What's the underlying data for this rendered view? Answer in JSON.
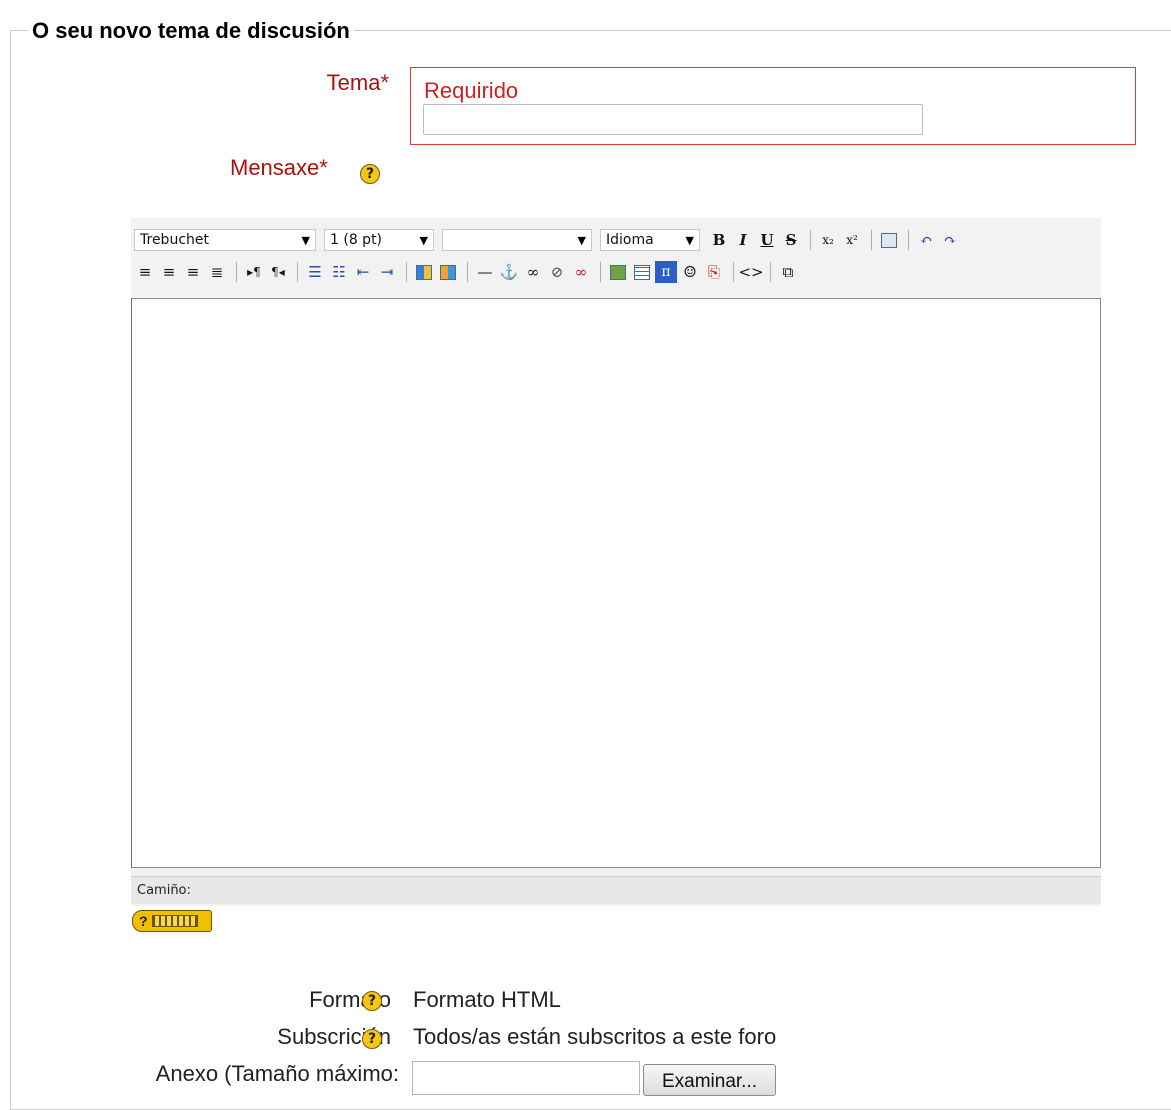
{
  "form": {
    "legend": "O seu novo tema de discusión",
    "tema_label": "Tema*",
    "tema_error": "Requirido",
    "tema_value": "",
    "mensaxe_label": "Mensaxe*",
    "help_glyph": "?"
  },
  "editor": {
    "font_family": "Trebuchet",
    "font_size": "1 (8 pt)",
    "heading": "",
    "language": "Idioma",
    "path_label": "Camiño:",
    "buttons_row1": [
      "bold",
      "italic",
      "underline",
      "strikethrough",
      "subscript",
      "superscript",
      "paste-word",
      "undo",
      "redo"
    ],
    "buttons_row2": [
      "align-left",
      "align-center",
      "align-right",
      "justify",
      "ltr",
      "rtl",
      "ordered-list",
      "unordered-list",
      "outdent",
      "indent",
      "text-color",
      "background-color",
      "horizontal-rule",
      "anchor",
      "insert-link",
      "unlink",
      "nolink",
      "insert-image",
      "insert-table",
      "insert-equation",
      "insert-smiley",
      "search-replace",
      "html-source",
      "fullscreen"
    ]
  },
  "fields": {
    "formato_label": "Formato",
    "formato_value": "Formato HTML",
    "subscricion_label": "Subscrición",
    "subscricion_value": "Todos/as están subscritos a este foro",
    "anexo_label": "Anexo (Tamaño máximo:",
    "browse_label": "Examinar..."
  }
}
